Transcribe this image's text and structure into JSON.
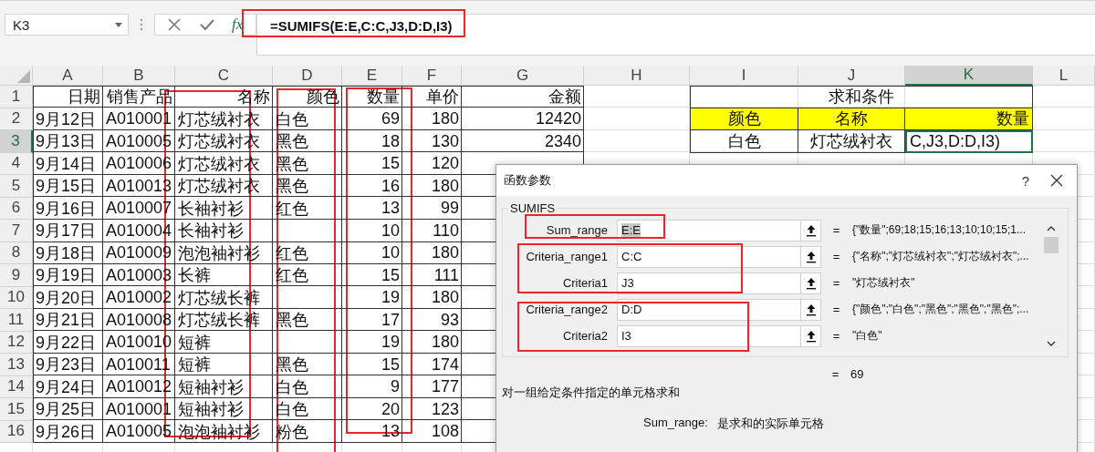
{
  "name_box": {
    "value": "K3"
  },
  "formula_bar": {
    "function_button": "fx",
    "formula": "=SUMIFS(E:E,C:C,J3,D:D,I3)"
  },
  "columns": [
    {
      "label": "A",
      "selected": false
    },
    {
      "label": "B",
      "selected": false
    },
    {
      "label": "C",
      "selected": false
    },
    {
      "label": "D",
      "selected": false
    },
    {
      "label": "E",
      "selected": false
    },
    {
      "label": "F",
      "selected": false
    },
    {
      "label": "G",
      "selected": false
    },
    {
      "label": "H",
      "selected": false
    },
    {
      "label": "I",
      "selected": false
    },
    {
      "label": "J",
      "selected": false
    },
    {
      "label": "K",
      "selected": true
    },
    {
      "label": "L",
      "selected": false
    }
  ],
  "rows": [
    {
      "number": "1",
      "selected": false,
      "kind": "header",
      "cells": [
        "日期",
        "销售产品",
        "名称",
        "颜色",
        "数量",
        "单价",
        "金额"
      ]
    },
    {
      "number": "2",
      "selected": false,
      "kind": "data",
      "cells": [
        "9月12日",
        "A010001",
        "灯芯绒衬衣",
        "白色",
        "69",
        "180",
        "12420"
      ]
    },
    {
      "number": "3",
      "selected": true,
      "kind": "data",
      "cells": [
        "9月13日",
        "A010005",
        "灯芯绒衬衣",
        "黑色",
        "18",
        "130",
        "2340"
      ]
    },
    {
      "number": "4",
      "selected": false,
      "kind": "data",
      "cells": [
        "9月14日",
        "A010006",
        "灯芯绒衬衣",
        "黑色",
        "15",
        "120"
      ]
    },
    {
      "number": "5",
      "selected": false,
      "kind": "data",
      "cells": [
        "9月15日",
        "A010013",
        "灯芯绒衬衣",
        "黑色",
        "16",
        "180"
      ]
    },
    {
      "number": "6",
      "selected": false,
      "kind": "data",
      "cells": [
        "9月16日",
        "A010007",
        "长袖衬衫",
        "红色",
        "13",
        "99"
      ]
    },
    {
      "number": "7",
      "selected": false,
      "kind": "data",
      "cells": [
        "9月17日",
        "A010004",
        "长袖衬衫",
        null,
        "10",
        "110"
      ]
    },
    {
      "number": "8",
      "selected": false,
      "kind": "data",
      "cells": [
        "9月18日",
        "A010009",
        "泡泡袖衬衫",
        "红色",
        "10",
        "180"
      ]
    },
    {
      "number": "9",
      "selected": false,
      "kind": "data",
      "cells": [
        "9月19日",
        "A010003",
        "长裤",
        "红色",
        "15",
        "111"
      ]
    },
    {
      "number": "10",
      "selected": false,
      "kind": "data",
      "cells": [
        "9月20日",
        "A010002",
        "灯芯绒长裤",
        null,
        "19",
        "180"
      ]
    },
    {
      "number": "11",
      "selected": false,
      "kind": "data",
      "cells": [
        "9月21日",
        "A010008",
        "灯芯绒长裤",
        "黑色",
        "17",
        "93"
      ]
    },
    {
      "number": "12",
      "selected": false,
      "kind": "data",
      "cells": [
        "9月22日",
        "A010010",
        "短裤",
        null,
        "19",
        "180"
      ]
    },
    {
      "number": "13",
      "selected": false,
      "kind": "data",
      "cells": [
        "9月23日",
        "A010011",
        "短裤",
        "黑色",
        "15",
        "174"
      ]
    },
    {
      "number": "14",
      "selected": false,
      "kind": "data",
      "cells": [
        "9月24日",
        "A010012",
        "短袖衬衫",
        "白色",
        "9",
        "177"
      ]
    },
    {
      "number": "15",
      "selected": false,
      "kind": "data",
      "cells": [
        "9月25日",
        "A010001",
        "短袖衬衫",
        "白色",
        "20",
        "123"
      ]
    },
    {
      "number": "16",
      "selected": false,
      "kind": "data",
      "cells": [
        "9月26日",
        "A010005",
        "泡泡袖衬衫",
        "粉色",
        "13",
        "108"
      ]
    }
  ],
  "criteria_table": {
    "title": "求和条件",
    "headers": [
      "颜色",
      "名称",
      "数量"
    ],
    "values": [
      {
        "text": "白色",
        "active": false
      },
      {
        "text": "灯芯绒衬衣",
        "active": false
      },
      {
        "text": "C,J3,D:D,I3)",
        "active": true
      }
    ]
  },
  "dialog": {
    "title": "函数参数",
    "help": "?",
    "function_name": "SUMIFS",
    "arguments": [
      {
        "label": "Sum_range",
        "value": "E:E",
        "value_selected": true,
        "equals": "=",
        "result": "{\"数量\";69;18;15;16;13;10;10;15;1..."
      },
      {
        "label": "Criteria_range1",
        "value": "C:C",
        "value_selected": false,
        "equals": "=",
        "result": "{\"名称\";\"灯芯绒衬衣\";\"灯芯绒衬衣\";..."
      },
      {
        "label": "Criteria1",
        "value": "J3",
        "value_selected": false,
        "equals": "=",
        "result": "\"灯芯绒衬衣\""
      },
      {
        "label": "Criteria_range2",
        "value": "D:D",
        "value_selected": false,
        "equals": "=",
        "result": "{\"颜色\";\"白色\";\"黑色\";\"黑色\";\"黑色\";..."
      },
      {
        "label": "Criteria2",
        "value": "I3",
        "value_selected": false,
        "equals": "=",
        "result": "\"白色\""
      }
    ],
    "formula_result": {
      "equals": "=",
      "value": "69"
    },
    "description": "对一组给定条件指定的单元格求和",
    "argument_help": {
      "name": "Sum_range:",
      "text": "是求和的实际单元格"
    }
  }
}
